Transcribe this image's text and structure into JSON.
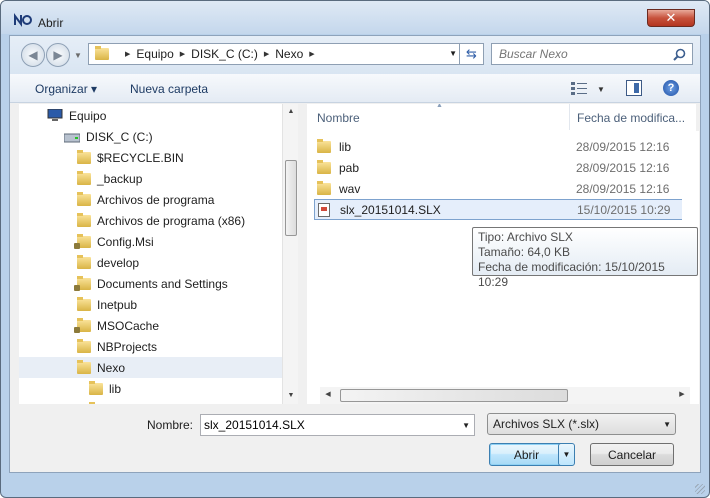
{
  "window": {
    "title": "Abrir",
    "close_label": "✕"
  },
  "nav": {
    "back_glyph": "◀",
    "forward_glyph": "▶",
    "breadcrumb": [
      "Equipo",
      "DISK_C (C:)",
      "Nexo"
    ],
    "search_placeholder": "Buscar Nexo"
  },
  "toolbar": {
    "organize_label": "Organizar ▾",
    "new_folder_label": "Nueva carpeta",
    "help_glyph": "?"
  },
  "tree": {
    "items": [
      {
        "label": "Equipo",
        "icon": "computer-icon"
      },
      {
        "label": "DISK_C (C:)",
        "icon": "drive-icon"
      },
      {
        "label": "$RECYCLE.BIN",
        "icon": "folder-icon"
      },
      {
        "label": "_backup",
        "icon": "folder-icon"
      },
      {
        "label": "Archivos de programa",
        "icon": "folder-icon"
      },
      {
        "label": "Archivos de programa (x86)",
        "icon": "folder-icon"
      },
      {
        "label": "Config.Msi",
        "icon": "locked-folder-icon"
      },
      {
        "label": "develop",
        "icon": "folder-icon"
      },
      {
        "label": "Documents and Settings",
        "icon": "locked-folder-icon"
      },
      {
        "label": "Inetpub",
        "icon": "folder-icon"
      },
      {
        "label": "MSOCache",
        "icon": "locked-folder-icon"
      },
      {
        "label": "NBProjects",
        "icon": "folder-icon"
      },
      {
        "label": "Nexo",
        "icon": "folder-icon",
        "selected": true
      },
      {
        "label": "lib",
        "icon": "folder-icon"
      }
    ]
  },
  "filelist": {
    "columns": {
      "name": "Nombre",
      "date": "Fecha de modifica..."
    },
    "rows": [
      {
        "name": "lib",
        "date": "28/09/2015 12:16",
        "type": "folder"
      },
      {
        "name": "pab",
        "date": "28/09/2015 12:16",
        "type": "folder"
      },
      {
        "name": "wav",
        "date": "28/09/2015 12:16",
        "type": "folder"
      },
      {
        "name": "slx_20151014.SLX",
        "date": "15/10/2015 10:29",
        "type": "file",
        "selected": true
      }
    ],
    "tooltip": {
      "type": "Tipo: Archivo SLX",
      "size": "Tamaño: 64,0 KB",
      "modified": "Fecha de modificación: 15/10/2015 10:29"
    }
  },
  "footer": {
    "name_label": "Nombre:",
    "filename_value": "slx_20151014.SLX",
    "filetype_value": "Archivos SLX (*.slx)",
    "open_label": "Abrir",
    "cancel_label": "Cancelar"
  }
}
